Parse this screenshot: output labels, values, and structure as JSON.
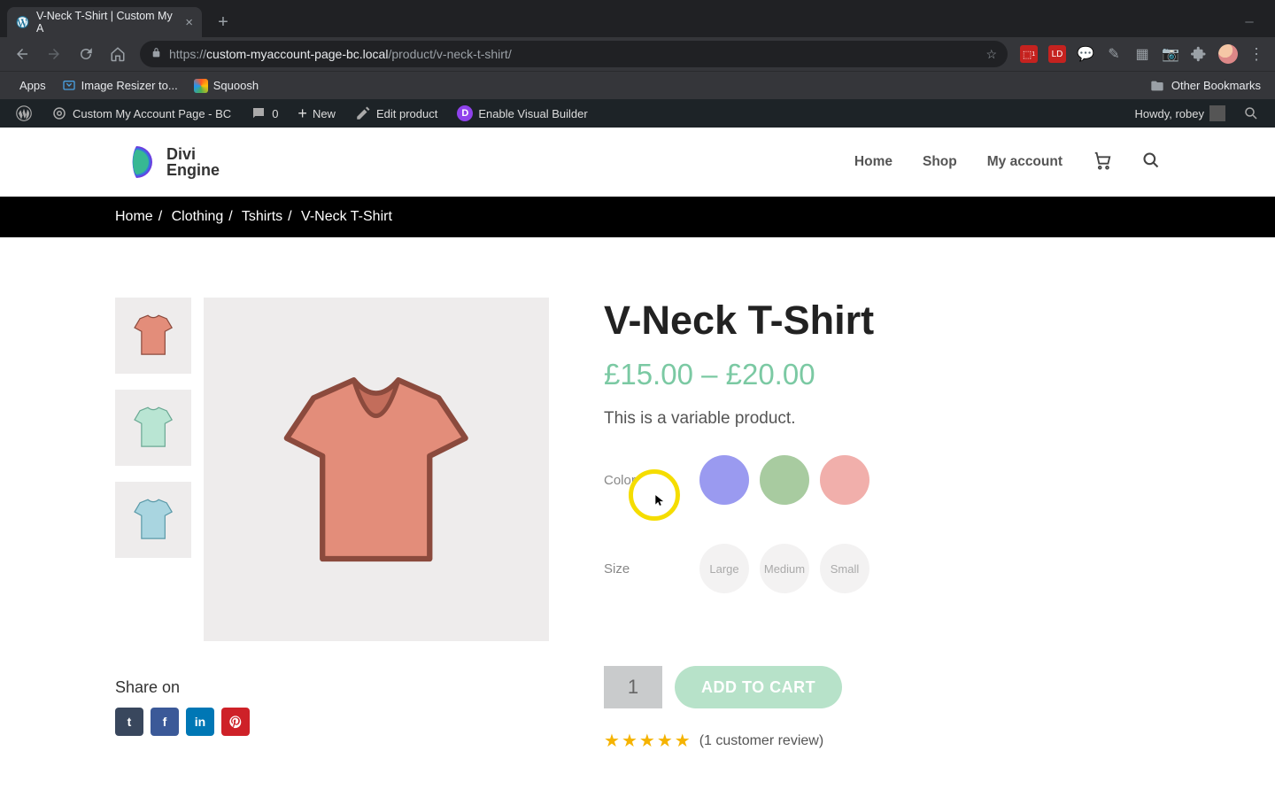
{
  "browser": {
    "tab_title": "V-Neck T-Shirt | Custom My A",
    "url_host": "custom-myaccount-page-bc.local",
    "url_path": "/product/v-neck-t-shirt/"
  },
  "bookmarks": {
    "apps": "Apps",
    "b1": "Image Resizer to...",
    "b2": "Squoosh",
    "other": "Other Bookmarks"
  },
  "wpbar": {
    "site_name": "Custom My Account Page - BC",
    "comments": "0",
    "new": "New",
    "edit": "Edit product",
    "visual_builder": "Enable Visual Builder",
    "howdy": "Howdy, robey"
  },
  "site": {
    "logo_line1": "Divi",
    "logo_line2": "Engine",
    "nav": {
      "home": "Home",
      "shop": "Shop",
      "account": "My account"
    }
  },
  "breadcrumb": {
    "home": "Home",
    "cat1": "Clothing",
    "cat2": "Tshirts",
    "current": "V-Neck T-Shirt"
  },
  "product": {
    "title": "V-Neck T-Shirt",
    "price_range": "£15.00 – £20.00",
    "description": "This is a variable product.",
    "color_label": "Color",
    "colors": [
      {
        "name": "blue",
        "hex": "#9a9af0"
      },
      {
        "name": "green",
        "hex": "#a8cba0"
      },
      {
        "name": "red",
        "hex": "#f1afab"
      }
    ],
    "size_label": "Size",
    "sizes": [
      "Large",
      "Medium",
      "Small"
    ],
    "qty": "1",
    "add_to_cart": "ADD TO CART",
    "rating_stars": 5,
    "review_text": "(1 customer review)"
  },
  "share": {
    "title": "Share on",
    "networks": [
      "tumblr",
      "facebook",
      "linkedin",
      "pinterest"
    ]
  }
}
